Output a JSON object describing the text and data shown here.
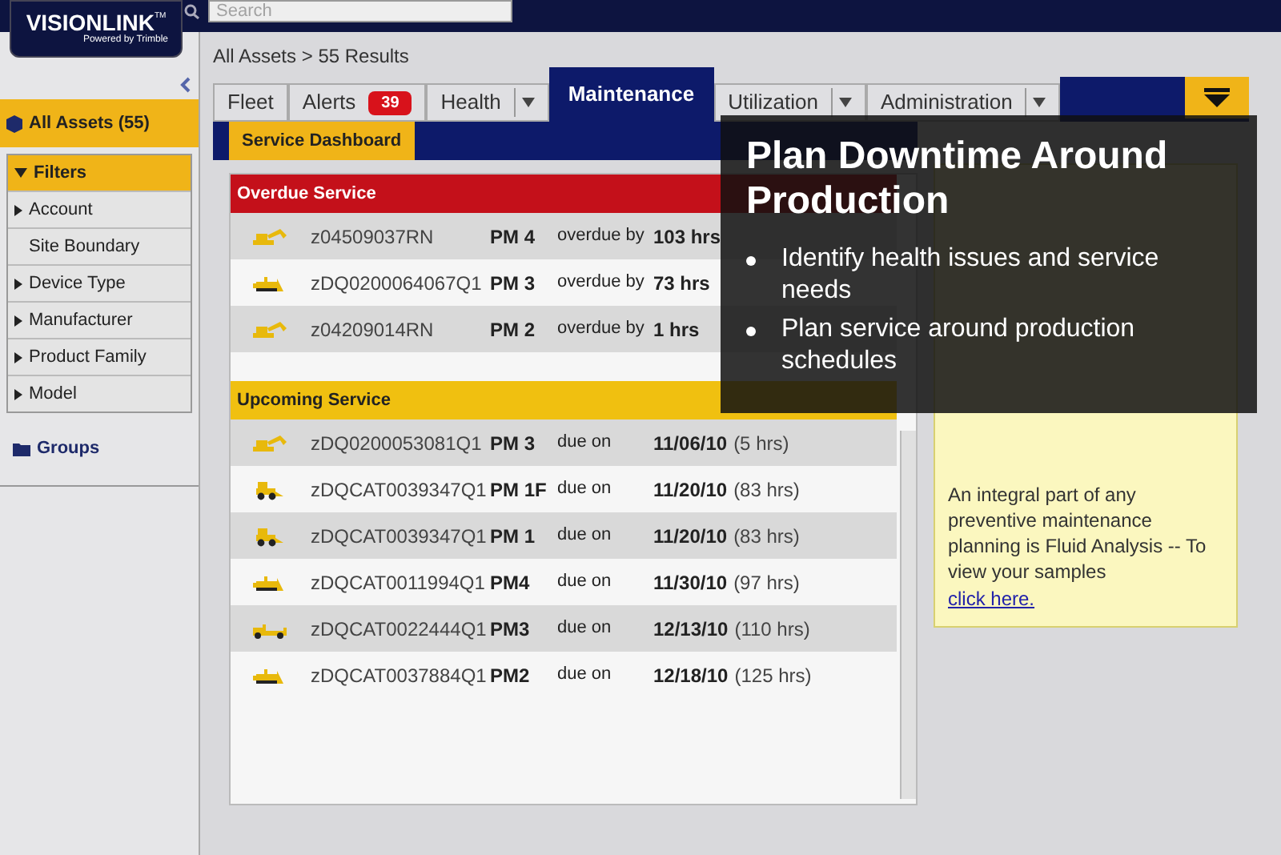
{
  "header": {
    "logo": "VISIONLINK",
    "logo_tm": "TM",
    "logo_sub": "Powered by Trimble",
    "search": {
      "placeholder": "Search"
    }
  },
  "sidebar": {
    "all_assets": "All Assets (55)",
    "filters_title": "Filters",
    "filters": [
      {
        "label": "Account",
        "expandable": true
      },
      {
        "label": "Site Boundary",
        "expandable": false
      },
      {
        "label": "Device Type",
        "expandable": true
      },
      {
        "label": "Manufacturer",
        "expandable": true
      },
      {
        "label": "Product Family",
        "expandable": true
      },
      {
        "label": "Model",
        "expandable": true
      }
    ],
    "groups": "Groups"
  },
  "breadcrumb": "All Assets > 55 Results",
  "tabs": [
    {
      "label": "Fleet",
      "selected": false,
      "menu": false
    },
    {
      "label": "Alerts",
      "selected": false,
      "menu": false,
      "badge": "39"
    },
    {
      "label": "Health",
      "selected": false,
      "menu": true
    },
    {
      "label": "Maintenance",
      "selected": true,
      "menu": false
    },
    {
      "label": "Utilization",
      "selected": false,
      "menu": true
    },
    {
      "label": "Administration",
      "selected": false,
      "menu": true
    }
  ],
  "subtab": "Service Dashboard",
  "sections": [
    {
      "kind": "overdue",
      "title": "Overdue Service",
      "rows": [
        {
          "kind": "excavator",
          "id": "z04509037RN",
          "pm": "PM 4",
          "status": "overdue by",
          "date": "103 hrs"
        },
        {
          "kind": "dozer",
          "id": "zDQ0200064067Q1",
          "pm": "PM 3",
          "status": "overdue by",
          "date": "73 hrs"
        },
        {
          "kind": "excavator",
          "id": "z04209014RN",
          "pm": "PM 2",
          "status": "overdue by",
          "date": "1 hrs"
        }
      ]
    },
    {
      "kind": "upcoming",
      "title": "Upcoming Service",
      "rows": [
        {
          "kind": "excavator",
          "id": "zDQ0200053081Q1",
          "pm": "PM 3",
          "status": "due on",
          "date": "11/06/10",
          "hours": "(5 hrs)"
        },
        {
          "kind": "loader",
          "id": "zDQCAT0039347Q1",
          "pm": "PM 1F",
          "status": "due on",
          "date": "11/20/10",
          "hours": "(83 hrs)"
        },
        {
          "kind": "loader",
          "id": "zDQCAT0039347Q1",
          "pm": "PM 1",
          "status": "due on",
          "date": "11/20/10",
          "hours": "(83 hrs)"
        },
        {
          "kind": "dozer",
          "id": "zDQCAT0011994Q1",
          "pm": "PM4",
          "status": "due on",
          "date": "11/30/10",
          "hours": "(97 hrs)"
        },
        {
          "kind": "scraper",
          "id": "zDQCAT0022444Q1",
          "pm": "PM3",
          "status": "due on",
          "date": "12/13/10",
          "hours": "(110 hrs)"
        },
        {
          "kind": "dozer",
          "id": "zDQCAT0037884Q1",
          "pm": "PM2",
          "status": "due on",
          "date": "12/18/10",
          "hours": "(125 hrs)"
        }
      ]
    }
  ],
  "note": {
    "text": "An integral part of any preventive maintenance planning is Fluid Analysis -- To view your samples",
    "link": "click here."
  },
  "overlay": {
    "title": "Plan Downtime Around Production",
    "bullets": [
      "Identify health issues and service needs",
      "Plan service around production schedules"
    ]
  }
}
